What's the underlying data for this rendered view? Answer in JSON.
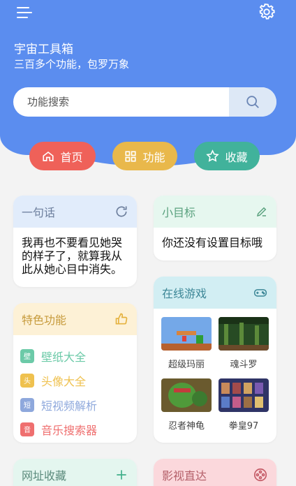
{
  "header": {
    "title": "宇宙工具箱",
    "subtitle": "三百多个功能，包罗万象",
    "search_placeholder": "功能搜索"
  },
  "nav": [
    {
      "label": "首页",
      "icon": "home-icon",
      "color": "#ef6159"
    },
    {
      "label": "功能",
      "icon": "grid-icon",
      "color": "#e9b84b"
    },
    {
      "label": "收藏",
      "icon": "star-icon",
      "color": "#41b29b"
    }
  ],
  "quote_card": {
    "title": "一句话",
    "text": "我再也不要看见她哭的样子了，就算我从此从她心目中消失。"
  },
  "goal_card": {
    "title": "小目标",
    "text": "你还没有设置目标哦"
  },
  "features_card": {
    "title": "特色功能",
    "items": [
      {
        "badge": "壁",
        "label": "壁纸大全",
        "color": "#6ccaa8"
      },
      {
        "badge": "头",
        "label": "头像大全",
        "color": "#efc14f"
      },
      {
        "badge": "短",
        "label": "短视频解析",
        "color": "#8ea8dc"
      },
      {
        "badge": "音",
        "label": "音乐搜索器",
        "color": "#ef6f6f"
      }
    ]
  },
  "games_card": {
    "title": "在线游戏",
    "games": [
      {
        "label": "超级玛丽"
      },
      {
        "label": "魂斗罗"
      },
      {
        "label": "忍者神龟"
      },
      {
        "label": "拳皇97"
      }
    ]
  },
  "url_card": {
    "title": "网址收藏"
  },
  "movie_card": {
    "title": "影视直达"
  }
}
